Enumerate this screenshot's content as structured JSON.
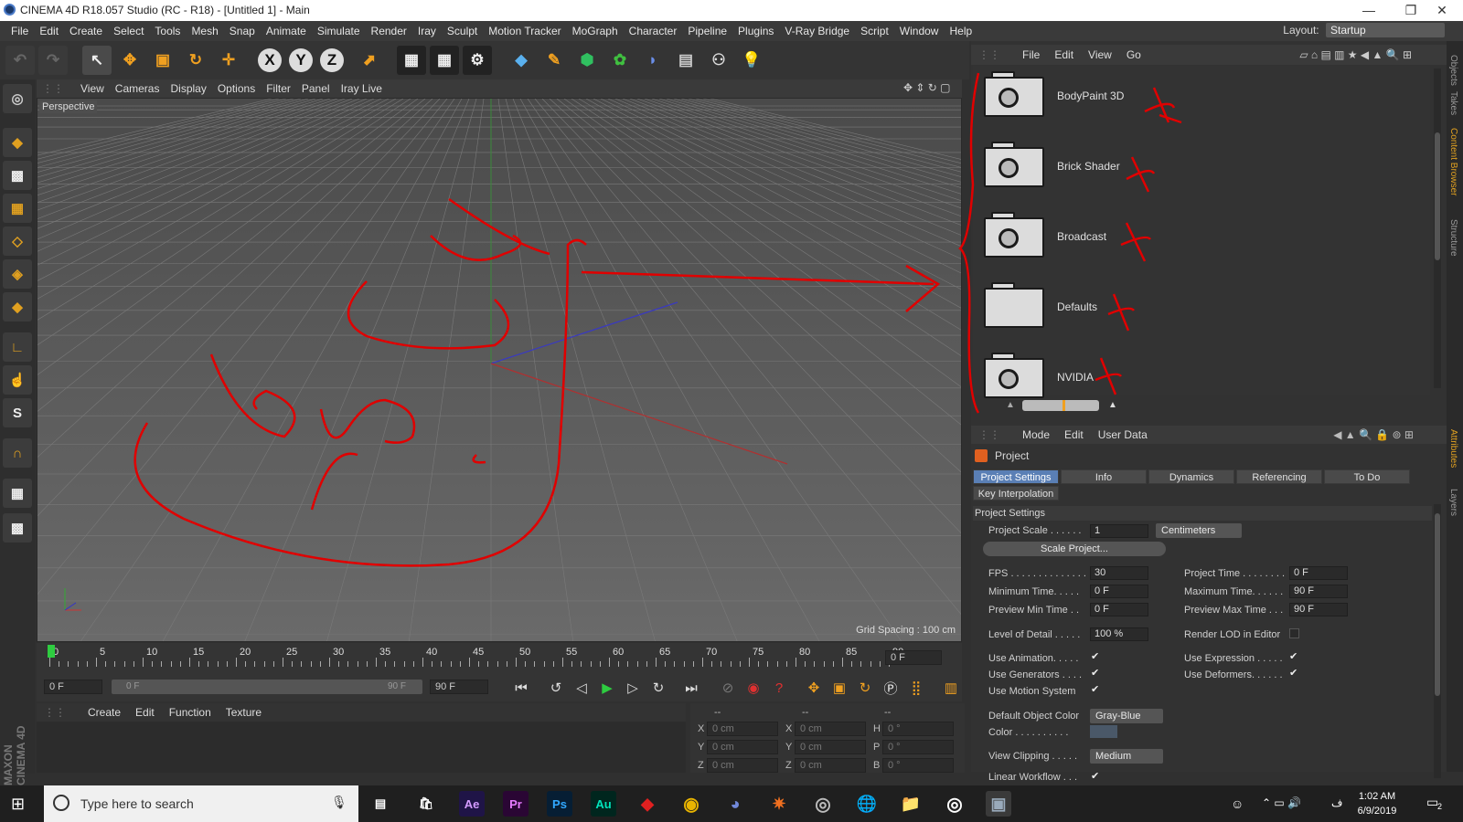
{
  "window": {
    "title": "CINEMA 4D R18.057 Studio (RC - R18) - [Untitled 1] - Main",
    "min": "—",
    "max": "❐",
    "close": "✕"
  },
  "menubar": [
    "File",
    "Edit",
    "Create",
    "Select",
    "Tools",
    "Mesh",
    "Snap",
    "Animate",
    "Simulate",
    "Render",
    "Iray",
    "Sculpt",
    "Motion Tracker",
    "MoGraph",
    "Character",
    "Pipeline",
    "Plugins",
    "V-Ray Bridge",
    "Script",
    "Window",
    "Help"
  ],
  "layout": {
    "label": "Layout:",
    "value": "Startup"
  },
  "toolbar": {
    "x_axis": "X",
    "y_axis": "Y",
    "z_axis": "Z"
  },
  "viewport": {
    "menu": [
      "View",
      "Cameras",
      "Display",
      "Options",
      "Filter",
      "Panel",
      "Iray Live"
    ],
    "label": "Perspective",
    "grid_spacing": "Grid Spacing : 100 cm"
  },
  "timeline": {
    "ticks": [
      "0",
      "5",
      "10",
      "15",
      "20",
      "25",
      "30",
      "35",
      "40",
      "45",
      "50",
      "55",
      "60",
      "65",
      "70",
      "75",
      "80",
      "85",
      "90"
    ],
    "current_frame": "0 F",
    "start": "0 F",
    "range_start": "0 F",
    "range_end": "90 F",
    "end": "90 F"
  },
  "material_menu": [
    "Create",
    "Edit",
    "Function",
    "Texture"
  ],
  "coords": {
    "header": [
      "--",
      "--",
      "--"
    ],
    "rows": [
      {
        "a": "X",
        "av": "0 cm",
        "b": "X",
        "bv": "0 cm",
        "c": "H",
        "cv": "0 °"
      },
      {
        "a": "Y",
        "av": "0 cm",
        "b": "Y",
        "bv": "0 cm",
        "c": "P",
        "cv": "0 °"
      },
      {
        "a": "Z",
        "av": "0 cm",
        "b": "Z",
        "bv": "0 cm",
        "c": "B",
        "cv": "0 °"
      }
    ]
  },
  "content_browser": {
    "menu": [
      "File",
      "Edit",
      "View",
      "Go"
    ],
    "items": [
      "BodyPaint 3D",
      "Brick Shader",
      "Broadcast",
      "Defaults",
      "NVIDIA"
    ]
  },
  "attributes": {
    "menu": [
      "Mode",
      "Edit",
      "User Data"
    ],
    "object": "Project",
    "tabs": [
      "Project Settings",
      "Info",
      "Dynamics",
      "Referencing",
      "To Do"
    ],
    "tab_row2": "Key Interpolation",
    "section": "Project Settings",
    "project_scale_label": "Project Scale . . . . . .",
    "project_scale": "1",
    "units": "Centimeters",
    "scale_button": "Scale Project...",
    "fps_label": "FPS . . . . . . . . . . . . . .",
    "fps": "30",
    "project_time_label": "Project Time . . . . . . . .",
    "project_time": "0 F",
    "min_time_label": "Minimum Time. . . . .",
    "min_time": "0 F",
    "max_time_label": "Maximum Time. . . . . .",
    "max_time": "90 F",
    "prev_min_label": "Preview Min Time . .",
    "prev_min": "0 F",
    "prev_max_label": "Preview Max Time . . .",
    "prev_max": "90 F",
    "lod_label": "Level of Detail . . . . .",
    "lod": "100 %",
    "render_lod_label": "Render LOD in Editor",
    "use_animation": "Use Animation. . . . .",
    "use_expression": "Use Expression . . . . .",
    "use_generators": "Use Generators . . . .",
    "use_deformers": "Use Deformers. . . . . .",
    "use_motion": "Use Motion System",
    "default_color_label": "Default Object Color",
    "default_color": "Gray-Blue",
    "color_label": "Color . . . . . . . . . .",
    "view_clipping_label": "View Clipping . . . . .",
    "view_clipping": "Medium",
    "linear_workflow": "Linear Workflow . . ."
  },
  "side_tabs": [
    "Objects",
    "Takes",
    "Content Browser",
    "Structure"
  ],
  "side_tabs2": [
    "Attributes",
    "Layers"
  ],
  "taskbar": {
    "search_placeholder": "Type here to search",
    "apps": [
      "Ae",
      "Pr",
      "Ps",
      "Au"
    ],
    "time": "1:02 AM",
    "date": "6/9/2019",
    "lang": "ف",
    "notif": "2"
  },
  "brand": "MAXON CINEMA 4D"
}
